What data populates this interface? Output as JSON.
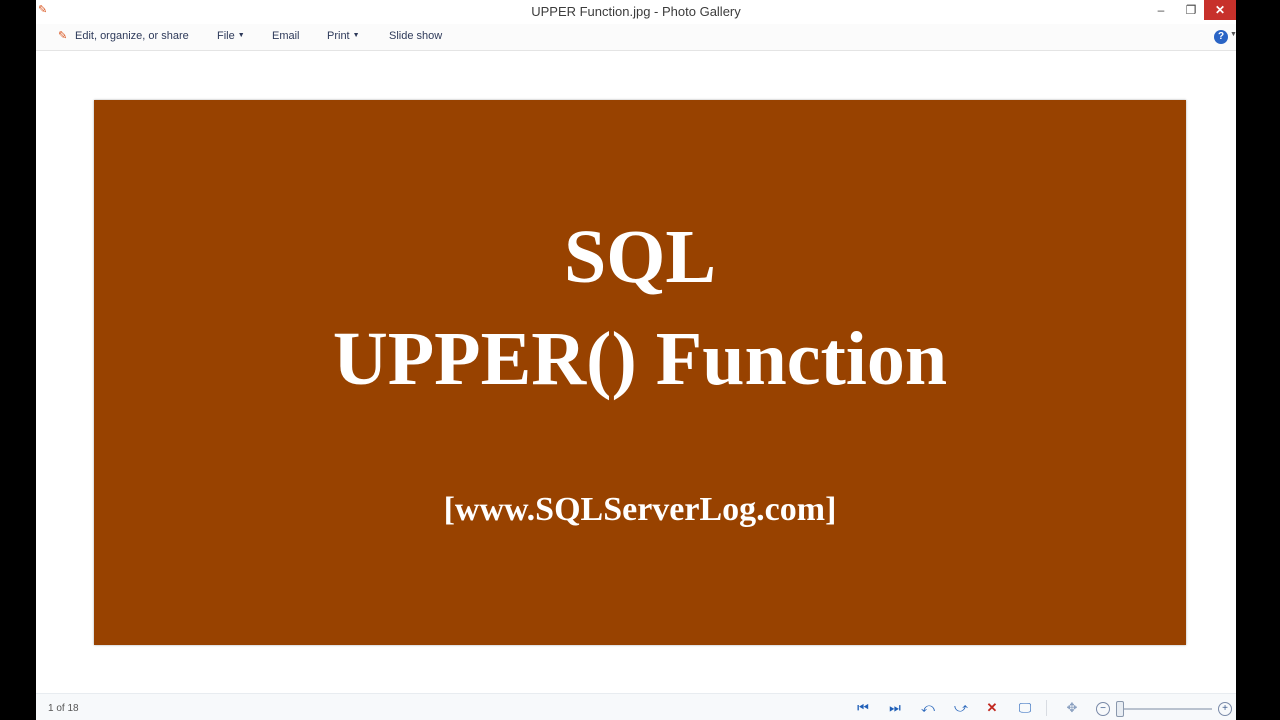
{
  "window": {
    "title": "UPPER Function.jpg - Photo Gallery",
    "minimize_glyph": "‒",
    "maximize_glyph": "❐",
    "close_glyph": "✕",
    "app_icon": "photo-gallery-icon"
  },
  "commandbar": {
    "edit_label": "Edit, organize, or share",
    "edit_icon": "edit-organize-icon",
    "file_label": "File",
    "email_label": "Email",
    "print_label": "Print",
    "slideshow_label": "Slide show",
    "dropdown_arrow": "▼",
    "help_glyph": "?"
  },
  "photo": {
    "line1": "SQL",
    "line2": "UPPER() Function",
    "line3": "[www.SQLServerLog.com]",
    "background_color": "#984200",
    "text_color": "#ffffff"
  },
  "statusbar": {
    "counter": "1 of 18",
    "first_glyph": "⏮",
    "next_glyph": "⏭",
    "rotate_left_glyph": "⤺",
    "rotate_right_glyph": "⤻",
    "delete_glyph": "✕",
    "desktop_glyph": "🖵",
    "fit_glyph": "✥",
    "zoom_out_glyph": "−",
    "zoom_in_glyph": "+",
    "zoom_level_fraction": 0.0
  }
}
